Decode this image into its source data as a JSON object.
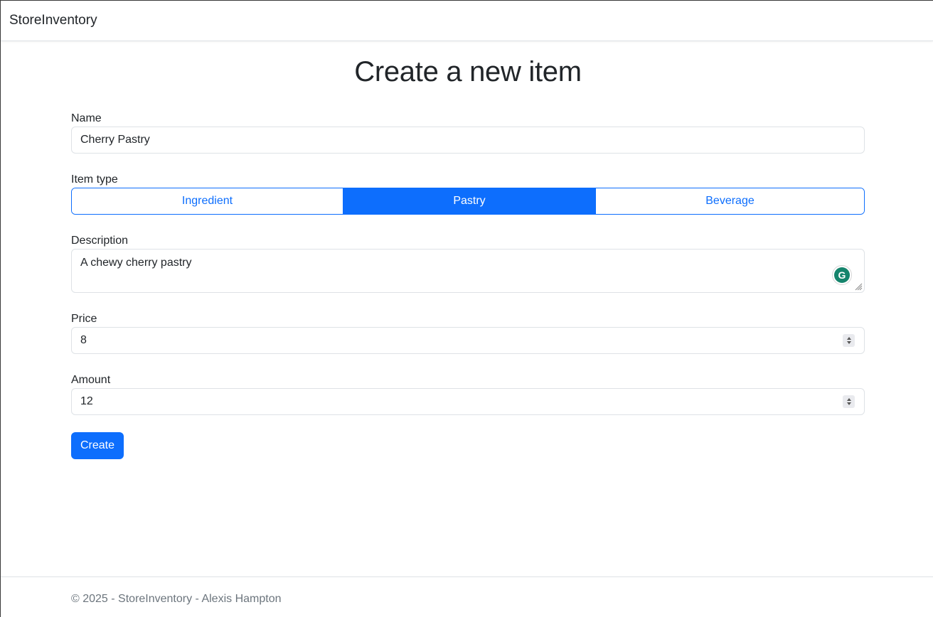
{
  "navbar": {
    "brand": "StoreInventory"
  },
  "page": {
    "title": "Create a new item"
  },
  "form": {
    "name": {
      "label": "Name",
      "value": "Cherry Pastry"
    },
    "item_type": {
      "label": "Item type",
      "options": [
        "Ingredient",
        "Pastry",
        "Beverage"
      ],
      "selected": "Pastry"
    },
    "description": {
      "label": "Description",
      "value": "A chewy cherry pastry"
    },
    "price": {
      "label": "Price",
      "value": "8"
    },
    "amount": {
      "label": "Amount",
      "value": "12"
    },
    "submit_label": "Create"
  },
  "extension": {
    "grammarly_icon": "grammarly-icon",
    "letter": "G"
  },
  "footer": {
    "text": "© 2025 - StoreInventory - Alexis Hampton"
  },
  "colors": {
    "primary": "#0d6efd",
    "text": "#212529",
    "muted": "#6c757d",
    "border": "#dee2e6",
    "grammarly": "#15846c"
  }
}
